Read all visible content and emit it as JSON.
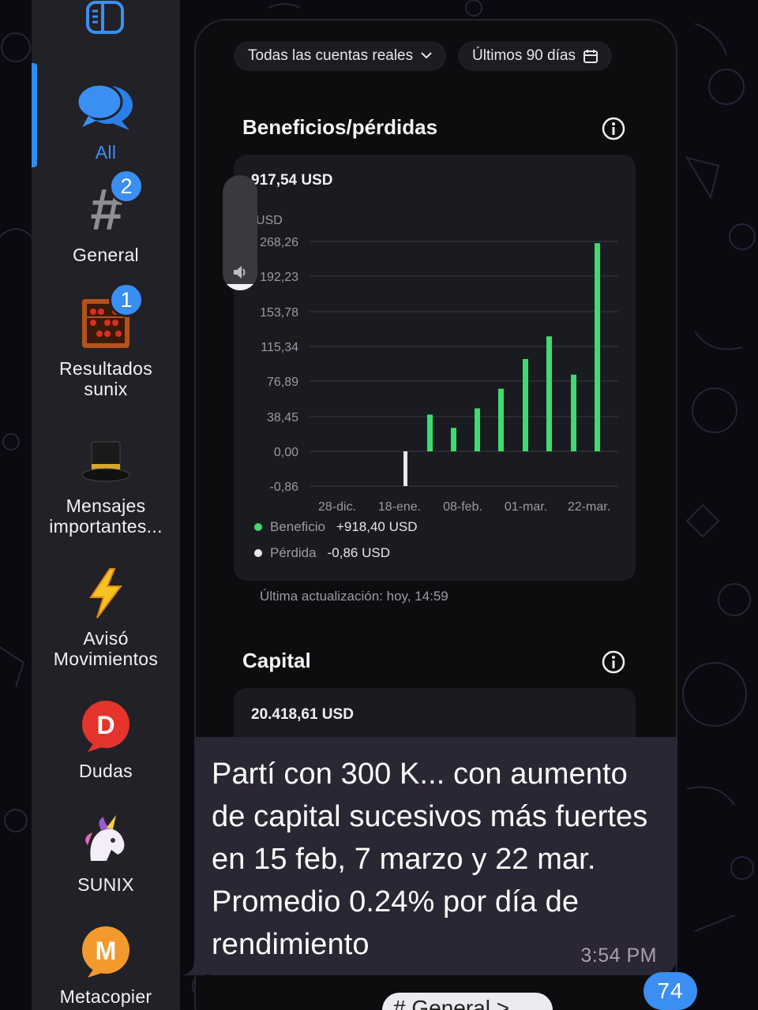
{
  "sidebar": {
    "items": [
      {
        "label": "All",
        "icon": "chat-bubbles-icon"
      },
      {
        "label": "General",
        "icon": "hashtag-icon",
        "badge": "2"
      },
      {
        "label": "Resultados\nsunix",
        "icon": "abacus-icon",
        "badge": "1"
      },
      {
        "label": "Mensajes\nimportantes...",
        "icon": "top-hat-icon"
      },
      {
        "label": "Avisó\nMovimientos",
        "icon": "lightning-icon"
      },
      {
        "label": "Dudas",
        "icon": "letter-d-icon",
        "glyph": "D"
      },
      {
        "label": "SUNIX",
        "icon": "unicorn-icon"
      },
      {
        "label": "Metacopier",
        "icon": "letter-m-icon",
        "glyph": "M"
      }
    ],
    "accent": "#3b8ff3"
  },
  "screenshot": {
    "account_filter": "Todas las cuentas reales",
    "period_filter": "Últimos 90 días",
    "profit_section": {
      "title": "Beneficios/pérdidas",
      "total": "917,54 USD",
      "legend": [
        {
          "label": "Beneficio",
          "value": "+918,40 USD",
          "color": "#3ddc6e"
        },
        {
          "label": "Pérdida",
          "value": "-0,86 USD",
          "color": "#e8e8ea"
        }
      ],
      "updated": "Última actualización: hoy, 14:59"
    },
    "capital_section": {
      "title": "Capital",
      "total": "20.418,61 USD"
    }
  },
  "chart_data": {
    "type": "bar",
    "ylabel": "USD",
    "yticks": [
      "268,26",
      "192,23",
      "153,78",
      "115,34",
      "76,89",
      "38,45",
      "0,00",
      "-0,86"
    ],
    "xticks": [
      "28-dic.",
      "18-ene.",
      "08-feb.",
      "01-mar.",
      "22-mar."
    ],
    "series": [
      {
        "name": "Pérdida",
        "color": "#e8e8ea",
        "points": [
          {
            "x": "18-ene.",
            "y": -0.86
          }
        ]
      },
      {
        "name": "Beneficio",
        "color": "#3ddc6e",
        "points": [
          {
            "x": "25-ene.",
            "y": 47
          },
          {
            "x": "01-feb.",
            "y": 30
          },
          {
            "x": "08-feb.",
            "y": 55
          },
          {
            "x": "15-feb.",
            "y": 80
          },
          {
            "x": "22-feb.",
            "y": 118
          },
          {
            "x": "01-mar.",
            "y": 147
          },
          {
            "x": "08-mar.",
            "y": 98
          },
          {
            "x": "15-mar.",
            "y": 266
          }
        ]
      }
    ],
    "grid": true,
    "legend_position": "bottom-left"
  },
  "message": {
    "text": "Partí con 300 K... con aumento de capital sucesivos más fuertes en 15 feb,  7 marzo y 22 mar. Promedio 0.24% por día de rendimiento",
    "time": "3:54 PM"
  },
  "unread_count": "74",
  "jump_chip": "# General >"
}
